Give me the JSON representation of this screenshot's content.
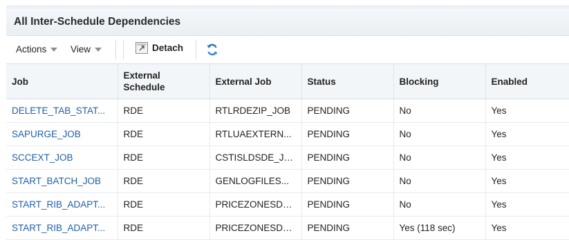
{
  "header": {
    "title": "All Inter-Schedule Dependencies"
  },
  "toolbar": {
    "actions_label": "Actions",
    "view_label": "View",
    "detach_label": "Detach"
  },
  "table": {
    "columns": [
      "Job",
      "External Schedule",
      "External Job",
      "Status",
      "Blocking",
      "Enabled"
    ],
    "rows": [
      {
        "job": "DELETE_TAB_STAT...",
        "ext_schedule": "RDE",
        "ext_job": "RTLRDEZIP_JOB",
        "status": "PENDING",
        "blocking": "No",
        "enabled": "Yes"
      },
      {
        "job": "SAPURGE_JOB",
        "ext_schedule": "RDE",
        "ext_job": "RTLUAEXTERN...",
        "status": "PENDING",
        "blocking": "No",
        "enabled": "Yes"
      },
      {
        "job": "SCCEXT_JOB",
        "ext_schedule": "RDE",
        "ext_job": "CSTISLDSDE_JOB",
        "status": "PENDING",
        "blocking": "No",
        "enabled": "Yes"
      },
      {
        "job": "START_BATCH_JOB",
        "ext_schedule": "RDE",
        "ext_job": "GENLOGFILES...",
        "status": "PENDING",
        "blocking": "No",
        "enabled": "Yes"
      },
      {
        "job": "START_RIB_ADAPT...",
        "ext_schedule": "RDE",
        "ext_job": "PRICEZONESDE...",
        "status": "PENDING",
        "blocking": "No",
        "enabled": "Yes"
      },
      {
        "job": "START_RIB_ADAPT...",
        "ext_schedule": "RDE",
        "ext_job": "PRICEZONESDE...",
        "status": "PENDING",
        "blocking": "Yes (118 sec)",
        "enabled": "Yes"
      }
    ]
  },
  "colors": {
    "link": "#1f5fa6",
    "header_bg": "#eaeff4",
    "refresh_blue": "#2f78c4"
  },
  "icons": {
    "detach": "detach-icon",
    "refresh": "refresh-icon",
    "dropdown": "chevron-down-icon"
  }
}
